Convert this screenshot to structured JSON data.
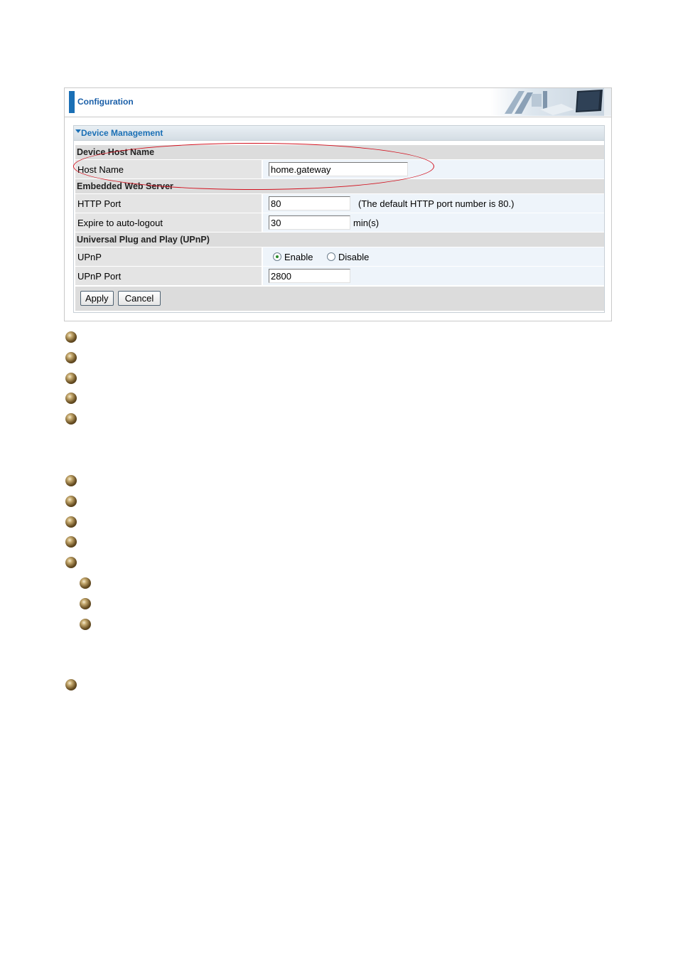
{
  "header": {
    "title": "Configuration"
  },
  "section": {
    "title": "Device Management"
  },
  "groups": {
    "host": {
      "title": "Device Host Name"
    },
    "web": {
      "title": "Embedded Web Server"
    },
    "upnp": {
      "title": "Universal Plug and Play (UPnP)"
    }
  },
  "fields": {
    "host_name": {
      "label": "Host Name",
      "value": "home.gateway"
    },
    "http_port": {
      "label": "HTTP Port",
      "value": "80",
      "note": "(The default HTTP port number is 80.)"
    },
    "expire": {
      "label": "Expire to auto-logout",
      "value": "30",
      "unit": "min(s)"
    },
    "upnp": {
      "label": "UPnP",
      "enable": "Enable",
      "disable": "Disable",
      "selected": "Enable"
    },
    "upnp_port": {
      "label": "UPnP Port",
      "value": "2800"
    }
  },
  "buttons": {
    "apply": "Apply",
    "cancel": "Cancel"
  },
  "colors": {
    "accent": "#1a6fb5",
    "highlight": "#d2101d"
  }
}
